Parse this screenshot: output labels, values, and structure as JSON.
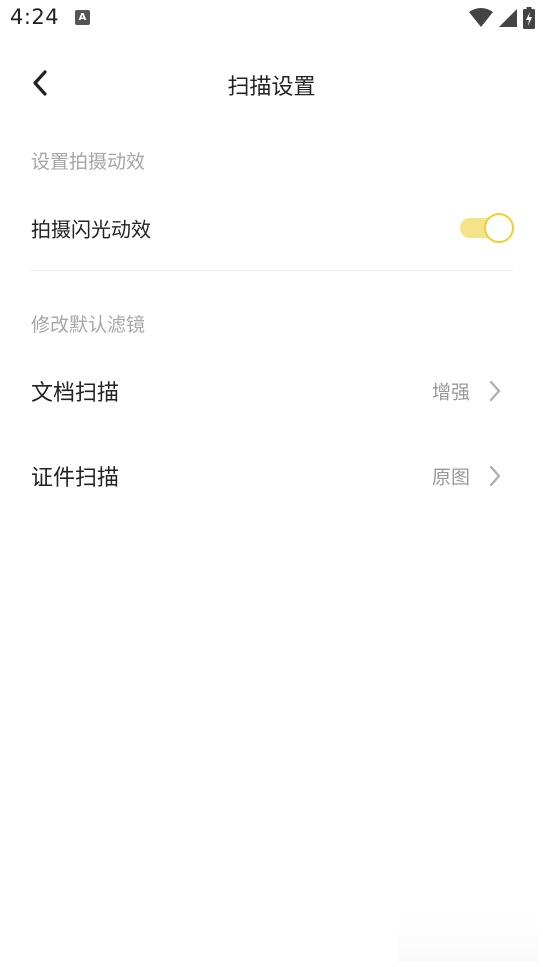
{
  "status_bar": {
    "time": "4:24",
    "app_icon_letter": "A",
    "icons": [
      "wifi-icon",
      "signal-icon",
      "battery-icon"
    ]
  },
  "header": {
    "title": "扫描设置",
    "back_icon": "chevron-left-icon"
  },
  "sections": {
    "animation": {
      "label": "设置拍摄动效",
      "flash_row": {
        "label": "拍摄闪光动效",
        "toggle_on": true
      }
    },
    "filters": {
      "label": "修改默认滤镜",
      "document_row": {
        "label": "文档扫描",
        "value": "增强"
      },
      "id_row": {
        "label": "证件扫描",
        "value": "原图"
      }
    }
  },
  "colors": {
    "accent": "#f2cf2e",
    "toggle_track": "#f5e38a",
    "secondary_text": "#a6a6a6",
    "value_text": "#999999"
  }
}
